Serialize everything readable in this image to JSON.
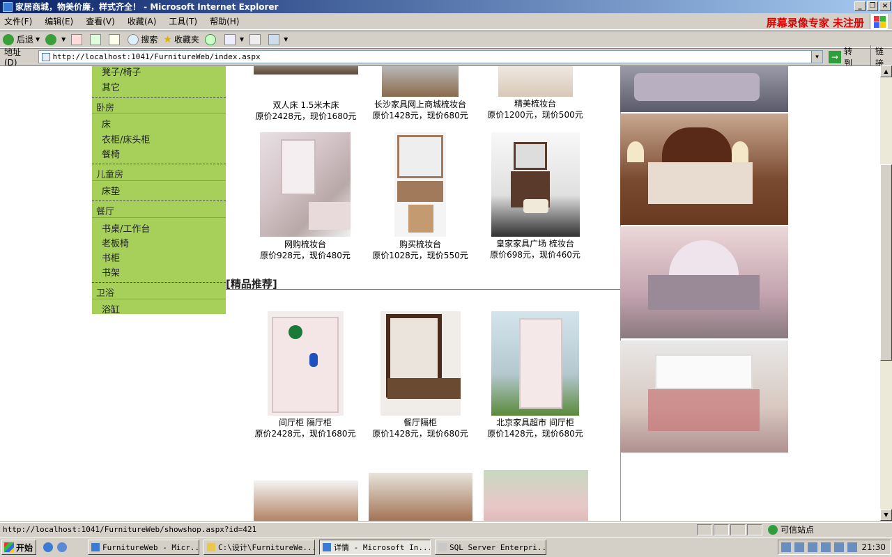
{
  "window": {
    "title": "家居商城，物美价廉，样式齐全！ - Microsoft Internet Explorer",
    "controls": [
      "_",
      "❐",
      "×"
    ]
  },
  "menubar": {
    "items": [
      "文件(F)",
      "编辑(E)",
      "查看(V)",
      "收藏(A)",
      "工具(T)",
      "帮助(H)"
    ],
    "watermark": "屏幕录像专家  未注册"
  },
  "toolbar": {
    "back": "后退",
    "search": "搜索",
    "favorites": "收藏夹"
  },
  "addressbar": {
    "label": "地址(D)",
    "url": "http://localhost:1041/FurnitureWeb/index.aspx",
    "go": "转到",
    "links": "链接"
  },
  "sidebar": {
    "top_items": [
      "凳子/椅子",
      "其它"
    ],
    "categories": [
      {
        "title": "卧房",
        "items": [
          "床",
          "衣柜/床头柜",
          "餐椅"
        ]
      },
      {
        "title": "儿童房",
        "items": [
          "床垫"
        ]
      },
      {
        "title": "餐厅",
        "items": [
          "书桌/工作台",
          "老板椅",
          "书柜",
          "书架"
        ]
      },
      {
        "title": "卫浴",
        "items": [
          "浴缸"
        ]
      }
    ]
  },
  "products_row1": [
    {
      "name": "双人床 1.5米木床",
      "price": "原价2428元，现价1680元"
    },
    {
      "name": "长沙家具网上商城梳妆台",
      "price": "原价1428元，现价680元"
    },
    {
      "name": "精美梳妆台",
      "price": "原价1200元，现价500元"
    }
  ],
  "products_row2": [
    {
      "name": "网购梳妆台",
      "price": "原价928元，现价480元"
    },
    {
      "name": "购买梳妆台",
      "price": "原价1028元，现价550元"
    },
    {
      "name": "皇家家具广场 梳妆台",
      "price": "原价698元，现价460元"
    }
  ],
  "recommend": {
    "title": "[精品推荐]",
    "products": [
      {
        "name": "间厅柜 隔厅柜",
        "price": "原价2428元，现价1680元"
      },
      {
        "name": "餐厅隔柜",
        "price": "原价1428元，现价680元"
      },
      {
        "name": "北京家具超市 间厅柜",
        "price": "原价1428元，现价680元"
      }
    ]
  },
  "statusbar": {
    "url": "http://localhost:1041/FurnitureWeb/showshop.aspx?id=421",
    "zone": "可信站点"
  },
  "taskbar": {
    "start": "开始",
    "tasks": [
      "FurnitureWeb - Micr...",
      "C:\\设计\\FurnitureWe...",
      "详情 - Microsoft In...",
      "SQL Server Enterpri..."
    ],
    "clock": "21:30"
  },
  "colors": {
    "sidebar_bg": "#a6d05a",
    "watermark": "#e00000",
    "titlebar": "#0a246a"
  }
}
